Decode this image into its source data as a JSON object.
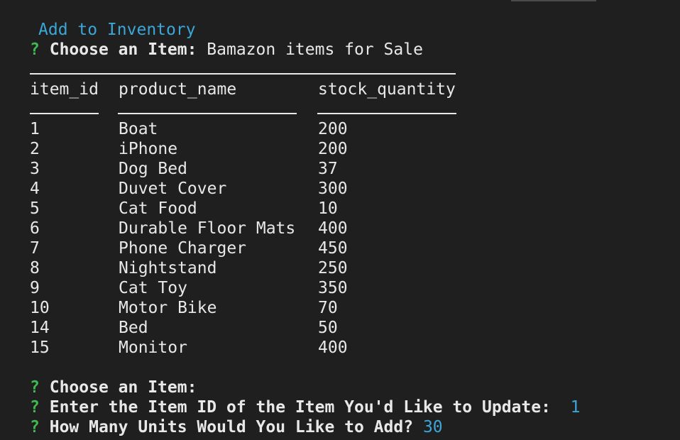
{
  "heading": "Add to Inventory",
  "prompt_mark": "?",
  "choose_label": "Choose an Item:",
  "choose_value": "Bamazon items for Sale",
  "table": {
    "columns": [
      "item_id",
      "product_name",
      "stock_quantity"
    ],
    "rows": [
      [
        "1",
        "Boat",
        "200"
      ],
      [
        "2",
        "iPhone",
        "200"
      ],
      [
        "3",
        "Dog Bed",
        "37"
      ],
      [
        "4",
        "Duvet Cover",
        "300"
      ],
      [
        "5",
        "Cat Food",
        "10"
      ],
      [
        "6",
        "Durable Floor Mats",
        "400"
      ],
      [
        "7",
        "Phone Charger",
        "450"
      ],
      [
        "8",
        "Nightstand",
        "250"
      ],
      [
        "9",
        "Cat Toy",
        "350"
      ],
      [
        "10",
        "Motor Bike",
        "70"
      ],
      [
        "14",
        "Bed",
        "50"
      ],
      [
        "15",
        "Monitor",
        "400"
      ]
    ]
  },
  "prompts": [
    {
      "label": "Choose an Item:",
      "answer": ""
    },
    {
      "label": "Enter the Item ID of the Item You'd Like to Update:",
      "answer": "1"
    },
    {
      "label": "How Many Units Would You Like to Add?",
      "answer": "30"
    }
  ]
}
